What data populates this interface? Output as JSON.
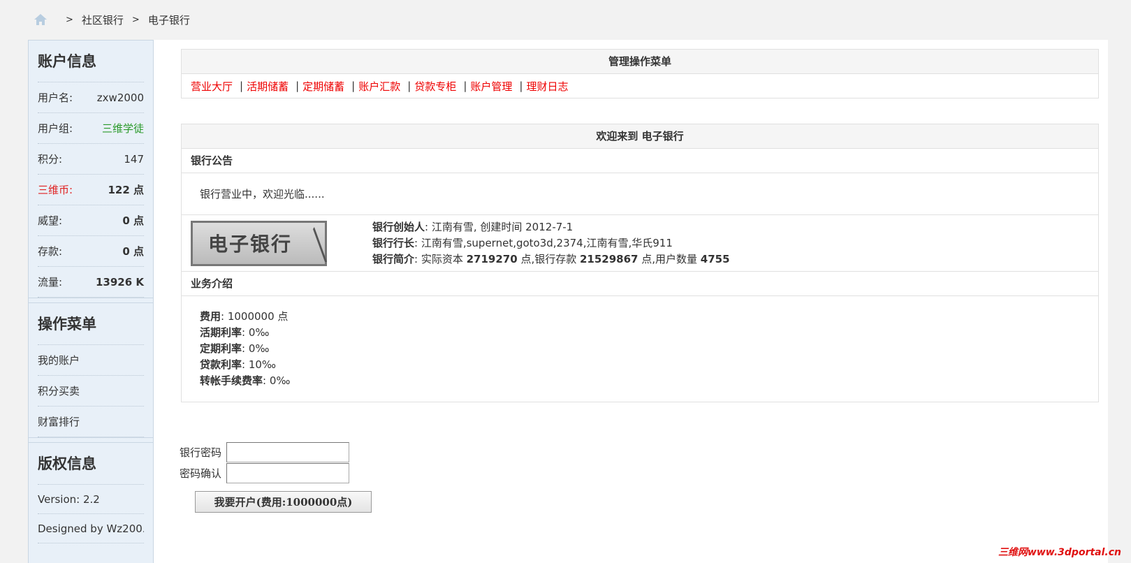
{
  "breadcrumb": {
    "items": [
      "社区银行",
      "电子银行"
    ],
    "separator": ">"
  },
  "account_info": {
    "title": "账户信息",
    "rows": [
      {
        "label": "用户名:",
        "value": "zxw2000"
      },
      {
        "label": "用户组:",
        "value": "三维学徒"
      },
      {
        "label": "积分:",
        "value": "147"
      },
      {
        "label": "三维币:",
        "value": "122 点"
      },
      {
        "label": "威望:",
        "value": "0 点"
      },
      {
        "label": "存款:",
        "value": "0 点"
      },
      {
        "label": "流量:",
        "value": "13926 K"
      }
    ]
  },
  "ops_menu": {
    "title": "操作菜单",
    "items": [
      "我的账户",
      "积分买卖",
      "财富排行"
    ]
  },
  "copyright": {
    "title": "版权信息",
    "version": "Version: 2.2",
    "designer": "Designed by Wz200..."
  },
  "admin_menu": {
    "title": "管理操作菜单",
    "items": [
      "营业大厅",
      "活期储蓄",
      "定期储蓄",
      "账户汇款",
      "贷款专柜",
      "账户管理",
      "理财日志"
    ]
  },
  "welcome": {
    "title": "欢迎来到 电子银行",
    "notice_title": "银行公告",
    "notice_text": "银行营业中，欢迎光临......",
    "logo_text": "电子银行",
    "founder_label": "银行创始人",
    "founder_value": ": 江南有雪, 创建时间 2012-7-1",
    "president_label": "银行行长",
    "president_value": ": 江南有雪,supernet,goto3d,2374,江南有雪,华氏911",
    "intro_label": "银行简介",
    "intro_pre": ": 实际资本 ",
    "capital": "2719270",
    "intro_mid": " 点,银行存款 ",
    "deposits": "21529867",
    "intro_mid2": " 点,用户数量 ",
    "users": "4755",
    "biz_title": "业务介绍",
    "biz": [
      {
        "label": "费用",
        "value": ": 1000000 点"
      },
      {
        "label": "活期利率",
        "value": ": 0‰"
      },
      {
        "label": "定期利率",
        "value": ": 0‰"
      },
      {
        "label": "贷款利率",
        "value": ": 10‰"
      },
      {
        "label": "转帐手续费率",
        "value": ": 0‰"
      }
    ]
  },
  "form": {
    "password_label": "银行密码",
    "confirm_label": "密码确认",
    "submit_label": "我要开户(费用:1000000点)"
  },
  "watermark": "三维网www.3dportal.cn"
}
